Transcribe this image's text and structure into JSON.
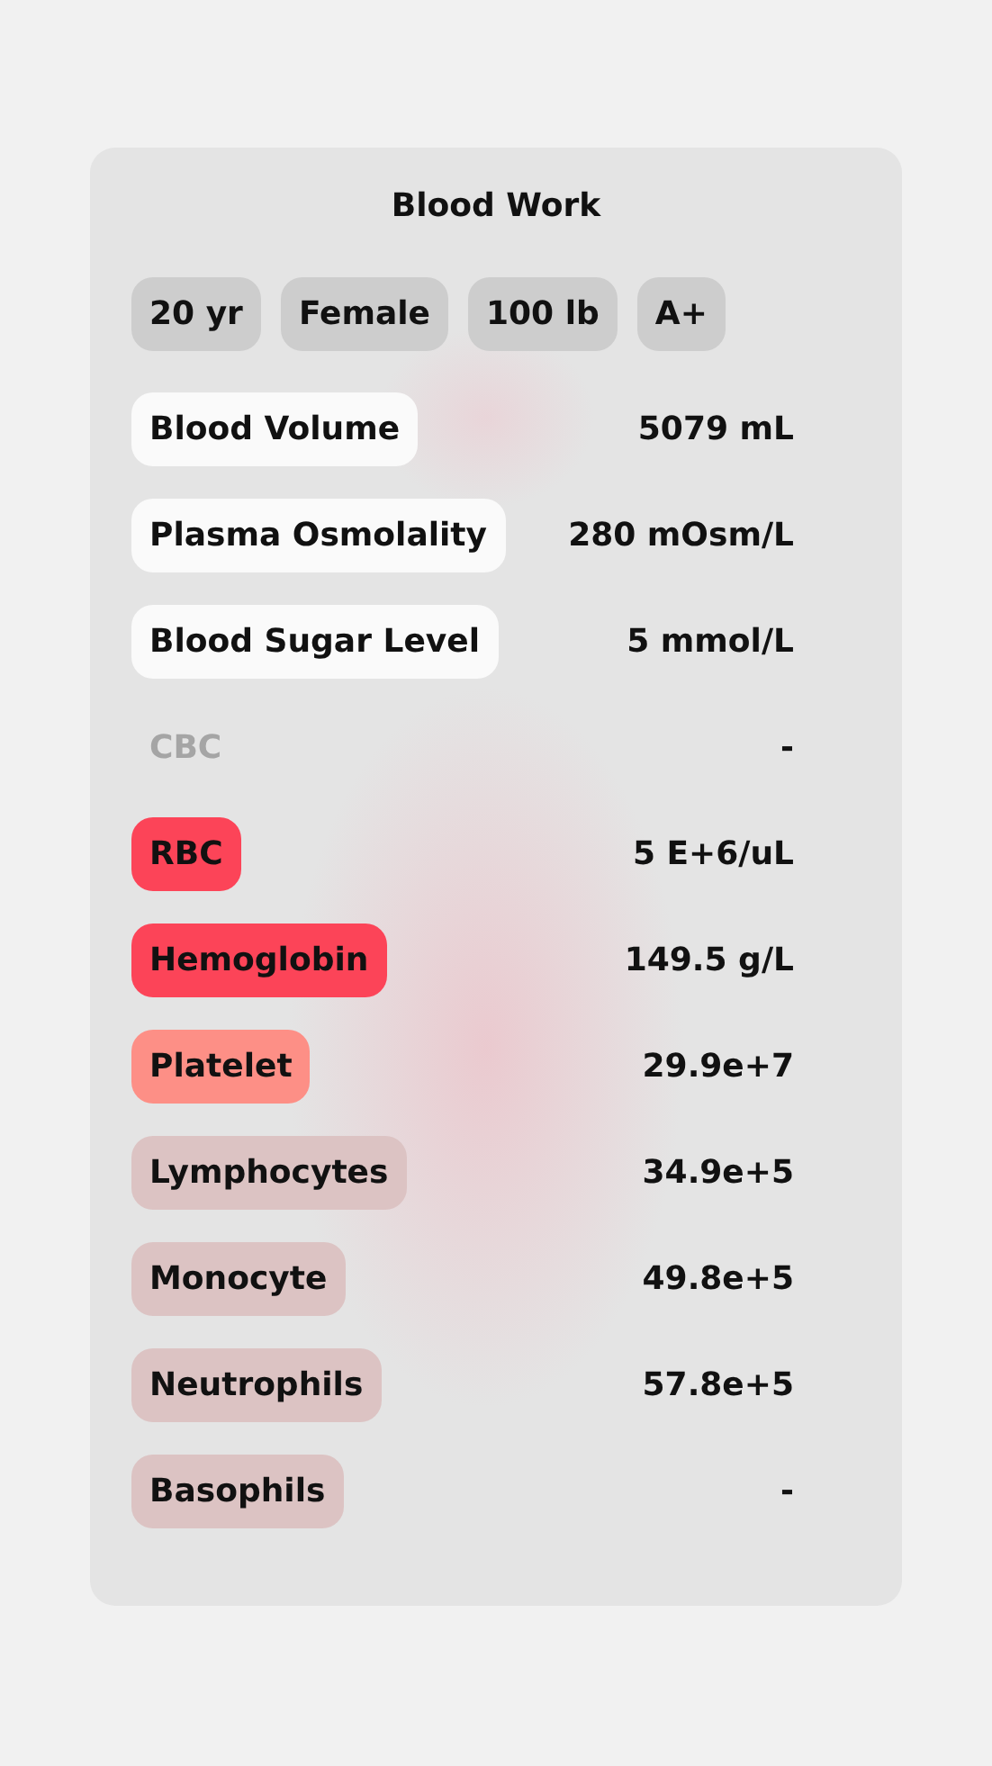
{
  "title": "Blood Work",
  "chips": [
    "20 yr",
    "Female",
    "100 lb",
    "A+"
  ],
  "rows": [
    {
      "kind": "pill",
      "label": "Blood Volume",
      "value": "5079 mL",
      "color": "#fafafa"
    },
    {
      "kind": "pill",
      "label": "Plasma Osmolality",
      "value": "280 mOsm/L",
      "color": "#fafafa"
    },
    {
      "kind": "pill",
      "label": "Blood Sugar Level",
      "value": "5 mmol/L",
      "color": "#fafafa"
    },
    {
      "kind": "header",
      "label": "CBC",
      "value": "-"
    },
    {
      "kind": "pill",
      "label": "RBC",
      "value": "5 E+6/uL",
      "color": "#fc4458"
    },
    {
      "kind": "pill",
      "label": "Hemoglobin",
      "value": "149.5 g/L",
      "color": "#fc4458"
    },
    {
      "kind": "pill",
      "label": "Platelet",
      "value": "29.9e+7",
      "color": "#fd8f86"
    },
    {
      "kind": "pill",
      "label": "Lymphocytes",
      "value": "34.9e+5",
      "color": "#dcc3c3"
    },
    {
      "kind": "pill",
      "label": "Monocyte",
      "value": "49.8e+5",
      "color": "#dcc3c3"
    },
    {
      "kind": "pill",
      "label": "Neutrophils",
      "value": "57.8e+5",
      "color": "#dcc3c3"
    },
    {
      "kind": "pill",
      "label": "Basophils",
      "value": "-",
      "color": "#dcc3c3"
    }
  ]
}
